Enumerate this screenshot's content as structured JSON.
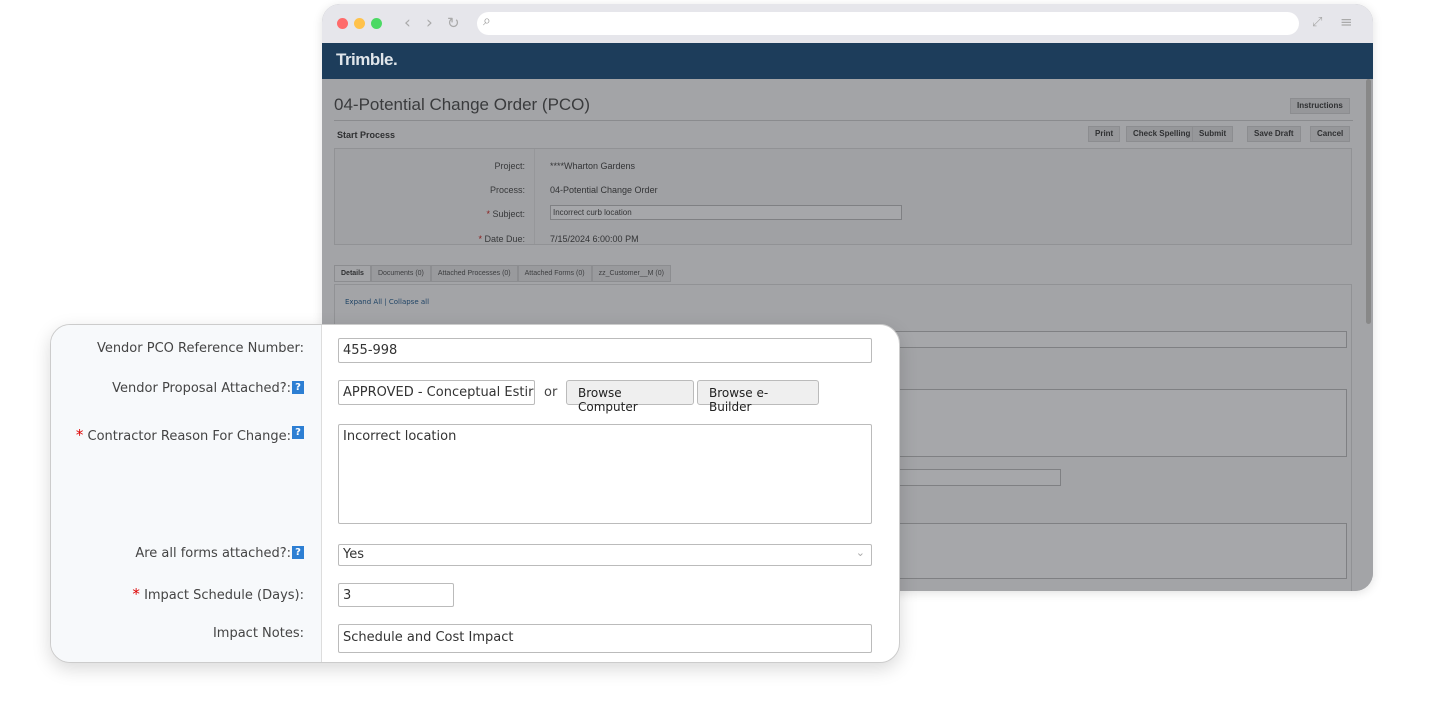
{
  "browser": {
    "url": "",
    "colors": {
      "red": "#ff6b6b",
      "yellow": "#ffc24b",
      "green": "#4cd964"
    }
  },
  "app": {
    "brand": "Trimble.",
    "page_title": "04-Potential Change Order (PCO)",
    "instructions_button": "Instructions",
    "section_title": "Start Process",
    "toolbar": [
      "Print",
      "Check Spelling",
      "Submit",
      "Save Draft",
      "Cancel"
    ],
    "fields": [
      {
        "label": "Project:",
        "value": "****Wharton Gardens",
        "required": false
      },
      {
        "label": "Process:",
        "value": "04-Potential Change Order",
        "required": false
      },
      {
        "label": "Subject:",
        "value": "Incorrect curb location",
        "required": true
      },
      {
        "label": "Date Due:",
        "value": "7/15/2024 6:00:00 PM",
        "required": true
      }
    ],
    "tabs": [
      "Details",
      "Documents (0)",
      "Attached Processes (0)",
      "Attached Forms (0)",
      "zz_Customer__M (0)"
    ],
    "expand_collapse": "Expand All | Collapse all"
  },
  "form": {
    "vendor_ref": {
      "label": "Vendor PCO Reference Number:",
      "value": "455-998"
    },
    "vendor_proposal": {
      "label": "Vendor Proposal Attached?:",
      "value": "APPROVED - Conceptual Estir",
      "or": "or",
      "browse_computer": "Browse Computer",
      "browse_ebuilder": "Browse e-Builder"
    },
    "reason": {
      "label": "Contractor Reason For Change:",
      "value": "Incorrect location",
      "required": true
    },
    "forms_attached": {
      "label": "Are all forms attached?:",
      "value": "Yes"
    },
    "impact_schedule": {
      "label": "Impact Schedule (Days):",
      "value": "3",
      "required": true
    },
    "impact_notes": {
      "label": "Impact Notes:",
      "value": "Schedule and Cost Impact"
    },
    "help": "?",
    "star": "*"
  }
}
